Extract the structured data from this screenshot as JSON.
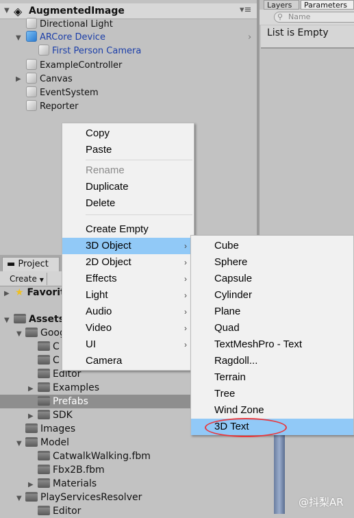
{
  "hierarchy": {
    "scene": "AugmentedImage",
    "items": [
      {
        "label": "Directional Light"
      },
      {
        "label": "ARCore Device"
      },
      {
        "label": "First Person Camera"
      },
      {
        "label": "ExampleController"
      },
      {
        "label": "Canvas"
      },
      {
        "label": "EventSystem"
      },
      {
        "label": "Reporter"
      }
    ]
  },
  "right_panel": {
    "tabs": [
      "Layers",
      "Parameters"
    ],
    "search_placeholder": "Name",
    "empty_text": "List is Empty"
  },
  "context_menu": {
    "items": [
      {
        "label": "Copy"
      },
      {
        "label": "Paste"
      },
      {
        "label": "Rename",
        "disabled": true
      },
      {
        "label": "Duplicate"
      },
      {
        "label": "Delete"
      },
      {
        "label": "Create Empty"
      },
      {
        "label": "3D Object",
        "highlighted": true
      },
      {
        "label": "2D Object"
      },
      {
        "label": "Effects"
      },
      {
        "label": "Light"
      },
      {
        "label": "Audio"
      },
      {
        "label": "Video"
      },
      {
        "label": "UI"
      },
      {
        "label": "Camera"
      }
    ]
  },
  "submenu": {
    "items": [
      {
        "label": "Cube"
      },
      {
        "label": "Sphere"
      },
      {
        "label": "Capsule"
      },
      {
        "label": "Cylinder"
      },
      {
        "label": "Plane"
      },
      {
        "label": "Quad"
      },
      {
        "label": "TextMeshPro - Text"
      },
      {
        "label": "Ragdoll..."
      },
      {
        "label": "Terrain"
      },
      {
        "label": "Tree"
      },
      {
        "label": "Wind Zone"
      },
      {
        "label": "3D Text",
        "highlighted": true
      }
    ],
    "highlight_annotation_color": "#e8383d"
  },
  "project": {
    "tab": "Project",
    "create": "Create",
    "favorites": "Favorites",
    "tree": [
      {
        "label": "Assets"
      },
      {
        "label": "GoogleARCore"
      },
      {
        "label": "C"
      },
      {
        "label": "C"
      },
      {
        "label": "Editor"
      },
      {
        "label": "Examples"
      },
      {
        "label": "Prefabs",
        "selected": true
      },
      {
        "label": "SDK"
      },
      {
        "label": "Images"
      },
      {
        "label": "Model"
      },
      {
        "label": "CatwalkWalking.fbm"
      },
      {
        "label": "Fbx2B.fbm"
      },
      {
        "label": "Materials"
      },
      {
        "label": "PlayServicesResolver"
      },
      {
        "label": "Editor"
      }
    ]
  },
  "watermark": "@抖梨AR"
}
